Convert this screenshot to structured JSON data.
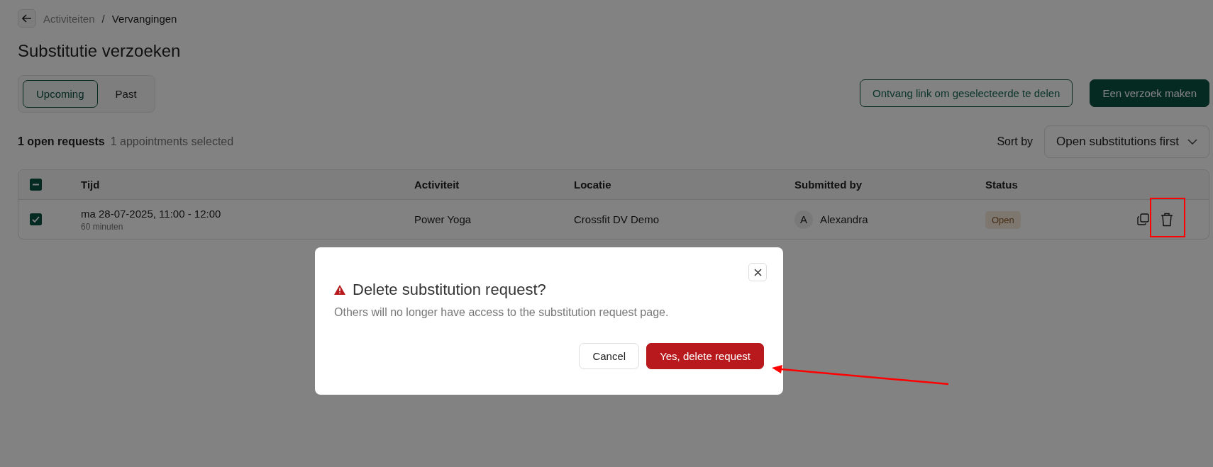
{
  "breadcrumb": {
    "items": [
      {
        "label": "Activiteiten",
        "current": false
      },
      {
        "label": "Vervangingen",
        "current": true
      }
    ],
    "separator": "/"
  },
  "page_title": "Substitutie verzoeken",
  "tabs": [
    {
      "label": "Upcoming",
      "selected": true
    },
    {
      "label": "Past",
      "selected": false
    }
  ],
  "actions": [
    {
      "label": "Ontvang link om geselecteerde te delen",
      "kind": "outline"
    },
    {
      "label": "Een verzoek maken",
      "kind": "primary"
    }
  ],
  "summary": {
    "open_count": "1 open requests",
    "selected_count": "1 appointments selected"
  },
  "sort": {
    "label": "Sort by",
    "value": "Open substitutions first"
  },
  "table": {
    "select_all": {
      "checked": true,
      "indeterminate": true
    },
    "columns": [
      "Tijd",
      "Activiteit",
      "Locatie",
      "Submitted by",
      "Status"
    ],
    "rows": [
      {
        "checked": true,
        "time": "ma 28-07-2025, 11:00 - 12:00",
        "duration": "60 minuten",
        "activity": "Power Yoga",
        "location": "Crossfit DV Demo",
        "submitter": {
          "initial": "A",
          "name": "Alexandra"
        },
        "status": {
          "label": "Open",
          "kind": "open"
        }
      }
    ]
  },
  "dialog": {
    "title": "Delete substitution request?",
    "message": "Others will no longer have access to the substitution request page.",
    "buttons": [
      {
        "label": "Cancel",
        "kind": "secondary"
      },
      {
        "label": "Yes, delete request",
        "kind": "danger"
      }
    ]
  },
  "annotations": {
    "delete_highlighted": true,
    "confirm_arrow": true
  }
}
